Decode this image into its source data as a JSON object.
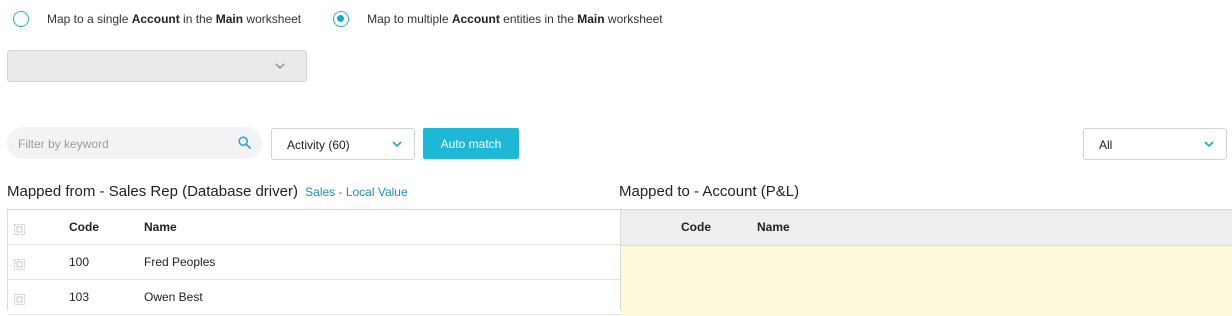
{
  "mapping_mode": {
    "options": [
      {
        "pre": "Map to a single ",
        "b1": "Account",
        "mid": " in the ",
        "b2": "Main",
        "post": " worksheet",
        "selected": false
      },
      {
        "pre": "Map to multiple ",
        "b1": "Account",
        "mid": " entities in the ",
        "b2": "Main",
        "post": " worksheet",
        "selected": true
      }
    ]
  },
  "entity_select": {
    "value": "",
    "disabled": true
  },
  "toolbar": {
    "search_placeholder": "Filter by keyword",
    "activity_filter": "Activity (60)",
    "auto_match_label": "Auto match",
    "right_filter": "All"
  },
  "left_panel": {
    "title": "Mapped from - Sales Rep (Database driver)",
    "subtitle": "Sales - Local Value",
    "columns": [
      "Code",
      "Name"
    ],
    "rows": [
      {
        "code": "100",
        "name": "Fred Peoples"
      },
      {
        "code": "103",
        "name": "Owen Best"
      }
    ]
  },
  "right_panel": {
    "title": "Mapped to - Account (P&L)",
    "columns": [
      "Code",
      "Name"
    ]
  },
  "colors": {
    "accent": "#1eb7d6",
    "link": "#1b8fb6",
    "mapped_bg": "#fef9db",
    "header_bg": "#eceeef"
  }
}
